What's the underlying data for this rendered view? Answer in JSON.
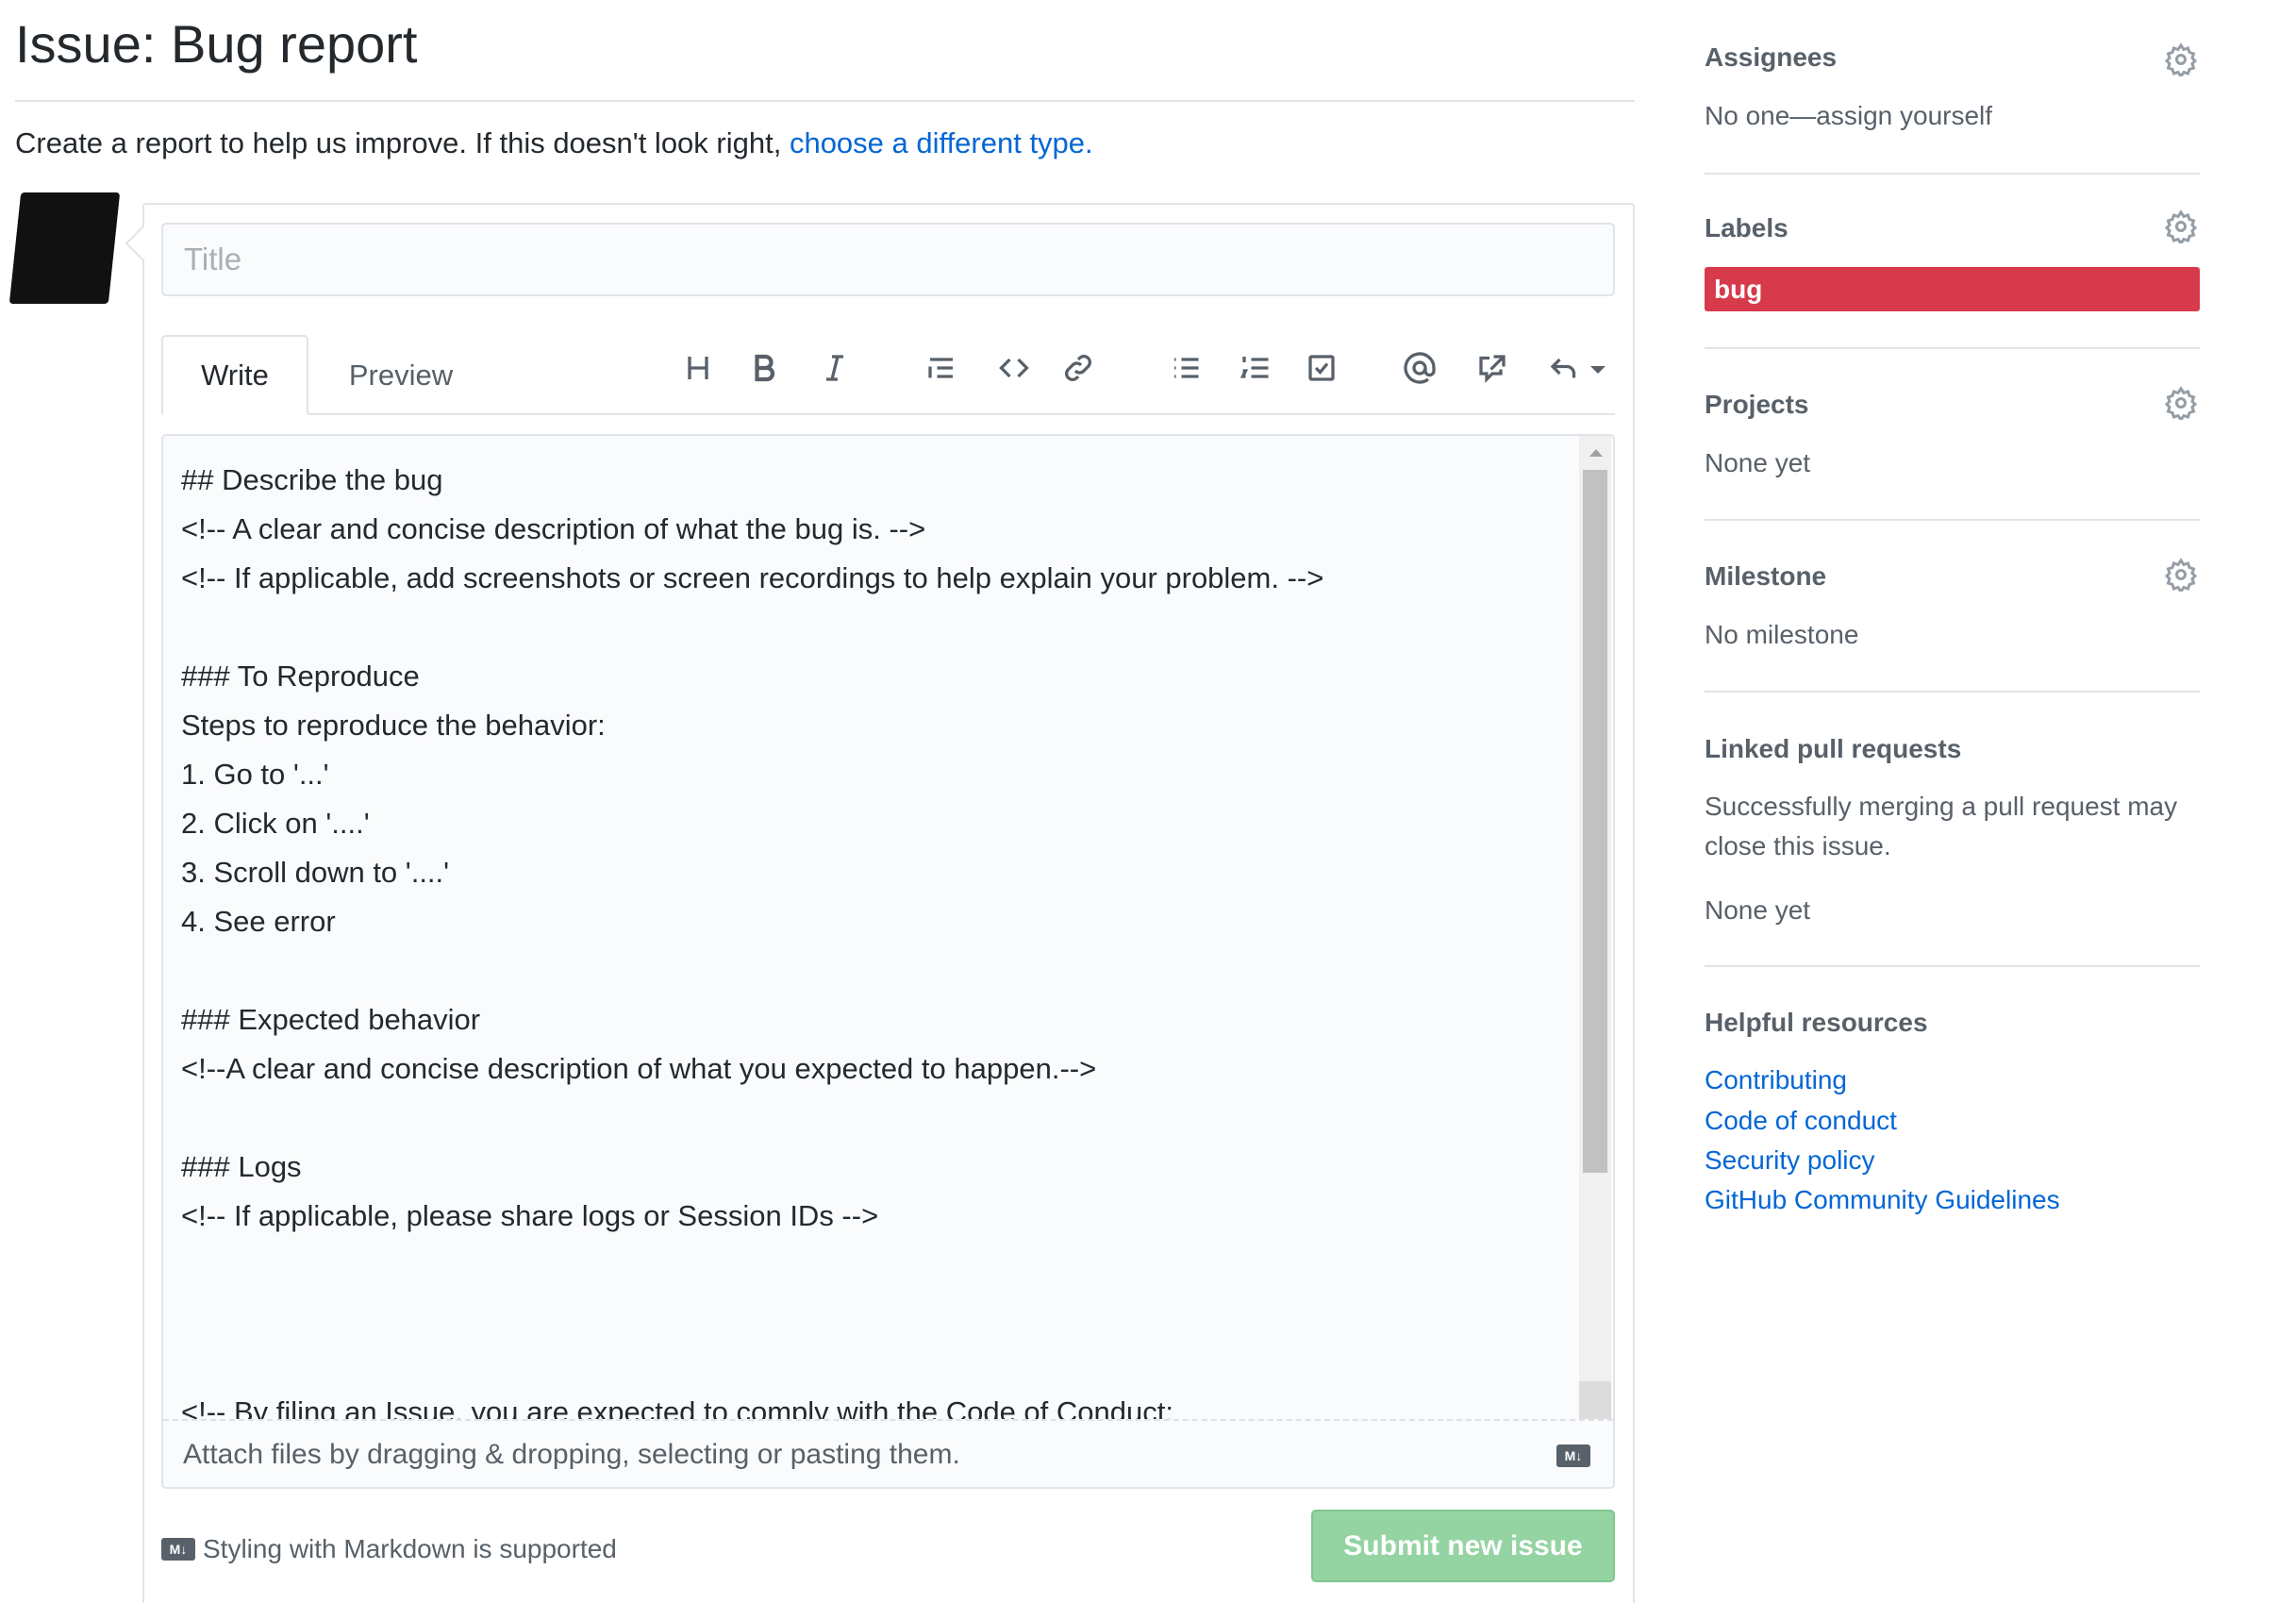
{
  "header": {
    "title": "Issue: Bug report",
    "description": "Create a report to help us improve. If this doesn't look right, ",
    "description_link": "choose a different type."
  },
  "form": {
    "title_placeholder": "Title",
    "tabs": [
      {
        "label": "Write",
        "active": true
      },
      {
        "label": "Preview",
        "active": false
      }
    ],
    "toolbar_icons": [
      "heading-icon",
      "bold-icon",
      "italic-icon",
      "quote-icon",
      "code-icon",
      "link-icon",
      "bulleted-list-icon",
      "numbered-list-icon",
      "task-list-icon",
      "mention-icon",
      "reference-icon",
      "reply-icon"
    ],
    "body": "## Describe the bug\n<!-- A clear and concise description of what the bug is. -->\n<!-- If applicable, add screenshots or screen recordings to help explain your problem. -->\n\n### To Reproduce\nSteps to reproduce the behavior:\n1. Go to '...'\n2. Click on '....'\n3. Scroll down to '....'\n4. See error\n\n### Expected behavior\n<!--A clear and concise description of what you expected to happen.-->\n\n### Logs\n<!-- If applicable, please share logs or Session IDs -->\n\n\n\n<!-- By filing an Issue, you are expected to comply with the Code of Conduct:",
    "attach_text": "Attach files by dragging & dropping, selecting or pasting them.",
    "markdown_badge": "M↓",
    "markdown_note": "Styling with Markdown is supported",
    "submit_label": "Submit new issue"
  },
  "sidebar": {
    "assignees": {
      "title": "Assignees",
      "value": "No one—assign yourself"
    },
    "labels": {
      "title": "Labels",
      "items": [
        {
          "name": "bug",
          "color": "#d73a4a"
        }
      ]
    },
    "projects": {
      "title": "Projects",
      "value": "None yet"
    },
    "milestone": {
      "title": "Milestone",
      "value": "No milestone"
    },
    "linked_prs": {
      "title": "Linked pull requests",
      "note_line1": "Successfully merging a pull request may",
      "note_line2": "close this issue.",
      "value": "None yet"
    },
    "resources": {
      "title": "Helpful resources",
      "links": [
        "Contributing",
        "Code of conduct",
        "Security policy",
        "GitHub Community Guidelines"
      ]
    }
  },
  "colors": {
    "link": "#0366d6",
    "submit_disabled": "#94d3a2",
    "label_bug": "#d73a4a"
  }
}
